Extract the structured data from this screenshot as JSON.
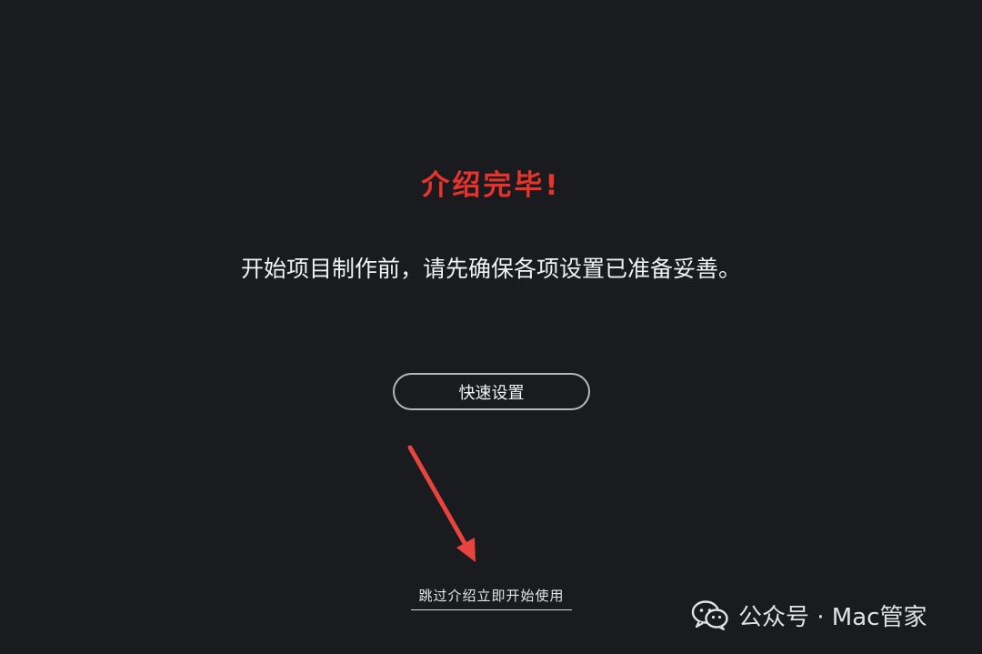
{
  "intro": {
    "title": "介绍完毕!",
    "subtitle": "开始项目制作前，请先确保各项设置已准备妥善。",
    "quick_setup_label": "快速设置",
    "skip_label": "跳过介绍立即开始使用"
  },
  "watermark": {
    "text": "公众号 · Mac管家",
    "icon": "wechat-icon"
  },
  "colors": {
    "background": "#191b1e",
    "title": "#e8322c",
    "arrow": "#e8433c",
    "text": "#f2f2f2"
  }
}
